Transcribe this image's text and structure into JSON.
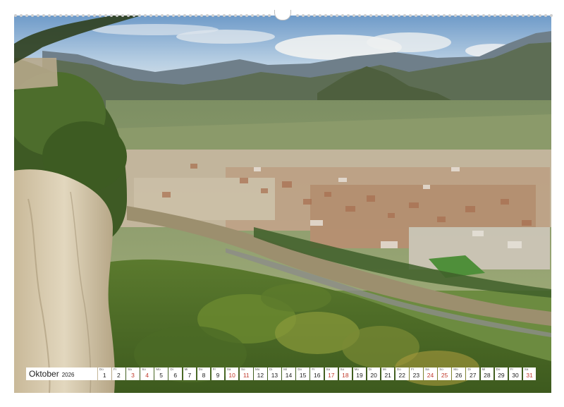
{
  "calendar": {
    "month": "Oktober",
    "year": "2026",
    "days": [
      {
        "dow": "Do",
        "num": "1",
        "weekend": false
      },
      {
        "dow": "Fr",
        "num": "2",
        "weekend": false
      },
      {
        "dow": "Sa",
        "num": "3",
        "weekend": true
      },
      {
        "dow": "So",
        "num": "4",
        "weekend": true
      },
      {
        "dow": "Mo",
        "num": "5",
        "weekend": false
      },
      {
        "dow": "Di",
        "num": "6",
        "weekend": false
      },
      {
        "dow": "Mi",
        "num": "7",
        "weekend": false
      },
      {
        "dow": "Do",
        "num": "8",
        "weekend": false
      },
      {
        "dow": "Fr",
        "num": "9",
        "weekend": false
      },
      {
        "dow": "Sa",
        "num": "10",
        "weekend": true
      },
      {
        "dow": "So",
        "num": "11",
        "weekend": true
      },
      {
        "dow": "Mo",
        "num": "12",
        "weekend": false
      },
      {
        "dow": "Di",
        "num": "13",
        "weekend": false
      },
      {
        "dow": "Mi",
        "num": "14",
        "weekend": false
      },
      {
        "dow": "Do",
        "num": "15",
        "weekend": false
      },
      {
        "dow": "Fr",
        "num": "16",
        "weekend": false
      },
      {
        "dow": "Sa",
        "num": "17",
        "weekend": true
      },
      {
        "dow": "So",
        "num": "18",
        "weekend": true
      },
      {
        "dow": "Mo",
        "num": "19",
        "weekend": false
      },
      {
        "dow": "Di",
        "num": "20",
        "weekend": false
      },
      {
        "dow": "Mi",
        "num": "21",
        "weekend": false
      },
      {
        "dow": "Do",
        "num": "22",
        "weekend": false
      },
      {
        "dow": "Fr",
        "num": "23",
        "weekend": false
      },
      {
        "dow": "Sa",
        "num": "24",
        "weekend": true
      },
      {
        "dow": "So",
        "num": "25",
        "weekend": true
      },
      {
        "dow": "Mo",
        "num": "26",
        "weekend": false
      },
      {
        "dow": "Di",
        "num": "27",
        "weekend": false
      },
      {
        "dow": "Mi",
        "num": "28",
        "weekend": false
      },
      {
        "dow": "Do",
        "num": "29",
        "weekend": false
      },
      {
        "dow": "Fr",
        "num": "30",
        "weekend": false
      },
      {
        "dow": "Sa",
        "num": "31",
        "weekend": true
      }
    ]
  },
  "colors": {
    "weekend": "#c0392b",
    "text": "#222222",
    "sky": "#9fc0dd",
    "river": "#9c8f6e",
    "cliff": "#d9ccb0"
  }
}
